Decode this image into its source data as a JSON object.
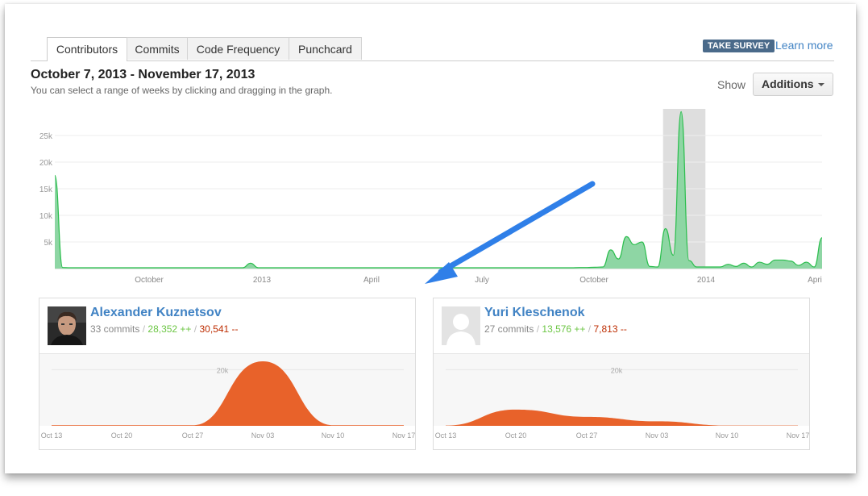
{
  "tabs": [
    {
      "label": "Contributors",
      "active": true
    },
    {
      "label": "Commits",
      "active": false
    },
    {
      "label": "Code Frequency",
      "active": false
    },
    {
      "label": "Punchcard",
      "active": false
    }
  ],
  "survey": {
    "badge": "TAKE SURVEY",
    "link": "Learn more"
  },
  "range": {
    "title": "October 7, 2013 - November 17, 2013",
    "subtitle": "You can select a range of weeks by clicking and dragging in the graph."
  },
  "show": {
    "label": "Show",
    "selected": "Additions"
  },
  "colors": {
    "accent": "#4183c4",
    "additions": "#6cc644",
    "deletions": "#bd2c00",
    "main_fill": "#8ed6a4",
    "main_line": "#2cbe4e",
    "contributor_fill": "#e8622a",
    "arrow": "#2f7fe8"
  },
  "chart_data": [
    {
      "type": "area",
      "y_ticks": [
        "5k",
        "10k",
        "15k",
        "20k",
        "25k"
      ],
      "ylim": [
        0,
        30000
      ],
      "x_tick_labels": [
        "October",
        "2013",
        "April",
        "July",
        "October",
        "2014",
        "Apri"
      ],
      "selection": {
        "from": "October 7, 2013",
        "to": "November 17, 2013"
      },
      "series": [
        {
          "values": [
            17500,
            200,
            150,
            150,
            150,
            150,
            150,
            150,
            150,
            150,
            150,
            150,
            150,
            150,
            150,
            150,
            150,
            150,
            150,
            150,
            150,
            150,
            150,
            150,
            150,
            1000,
            150,
            150,
            150,
            150,
            150,
            150,
            150,
            150,
            150,
            150,
            150,
            150,
            150,
            150,
            150,
            150,
            150,
            150,
            150,
            150,
            150,
            150,
            150,
            150,
            150,
            150,
            150,
            150,
            150,
            150,
            150,
            150,
            150,
            150,
            150,
            150,
            150,
            150,
            150,
            150,
            150,
            200,
            200,
            250,
            300,
            3500,
            1800,
            6000,
            4500,
            5000,
            400,
            300,
            7500,
            2500,
            29500,
            1500,
            300,
            300,
            300,
            300,
            800,
            400,
            1000,
            300,
            1200,
            800,
            1600,
            1600,
            1400,
            600,
            1200,
            300,
            5800
          ]
        }
      ]
    },
    {
      "type": "area",
      "contributor": "Alexander Kuznetsov",
      "y_ticks": [
        "20k"
      ],
      "ylim": [
        0,
        25000
      ],
      "x_tick_labels": [
        "Oct 13",
        "Oct 20",
        "Oct 27",
        "Nov 03",
        "Nov 10",
        "Nov 17"
      ],
      "series": [
        {
          "values": [
            200,
            200,
            200,
            23000,
            200,
            200
          ]
        }
      ]
    },
    {
      "type": "area",
      "contributor": "Yuri Kleschenok",
      "y_ticks": [
        "20k"
      ],
      "ylim": [
        0,
        25000
      ],
      "x_tick_labels": [
        "Oct 13",
        "Oct 20",
        "Oct 27",
        "Nov 03",
        "Nov 10",
        "Nov 17"
      ],
      "series": [
        {
          "values": [
            100,
            5800,
            3200,
            1600,
            100,
            100
          ]
        }
      ]
    }
  ],
  "contributors": [
    {
      "name": "Alexander Kuznetsov",
      "commits": "33 commits",
      "sep1": "/",
      "additions": "28,352 ++",
      "sep2": "/",
      "deletions": "30,541 --",
      "avatar": "photo"
    },
    {
      "name": "Yuri Kleschenok",
      "commits": "27 commits",
      "sep1": "/",
      "additions": "13,576 ++",
      "sep2": "/",
      "deletions": "7,813 --",
      "avatar": "default-avatar-icon"
    }
  ]
}
